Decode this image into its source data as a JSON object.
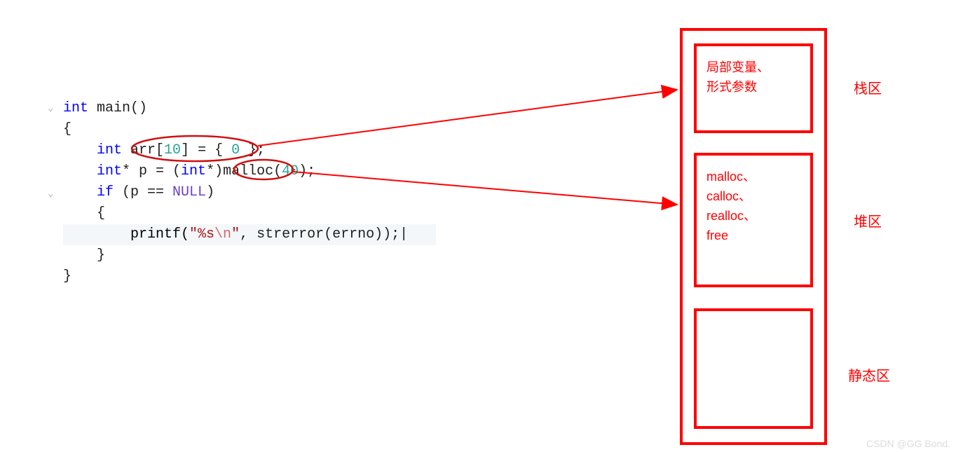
{
  "code": {
    "l1": "int main()",
    "kw_int": "int",
    "fn_main": " main()",
    "l2": "{",
    "l3_pre": "    ",
    "l3_kw": "int",
    "l3_arr": " arr[",
    "l3_size": "10",
    "l3_mid": "] = { ",
    "l3_zero": "0",
    "l3_end": " };",
    "l4_pre": "    ",
    "l4_kw": "int",
    "l4_ptr": "* p = (",
    "l4_kw2": "int",
    "l4_cast": "*)malloc(",
    "l4_arg": "40",
    "l4_end": ");",
    "l5_pre": "    ",
    "l5_kw": "if",
    "l5_cond1": " (p == ",
    "l5_null": "NULL",
    "l5_cond2": ")",
    "l6": "    {",
    "l7_pre": "        printf(",
    "l7_str1": "\"%s",
    "l7_esc": "\\n",
    "l7_str2": "\"",
    "l7_rest": ", strerror(errno));",
    "l7_cursor": "|",
    "l8": "    }",
    "l9": "}"
  },
  "memory": {
    "stack": {
      "line1": "局部变量、",
      "line2": "形式参数"
    },
    "heap": {
      "line1": "malloc、",
      "line2": "calloc、",
      "line3": "realloc、",
      "line4": "free"
    },
    "labels": {
      "stack": "栈区",
      "heap": "堆区",
      "static": "静态区"
    }
  },
  "watermark": "CSDN @GG Bond."
}
